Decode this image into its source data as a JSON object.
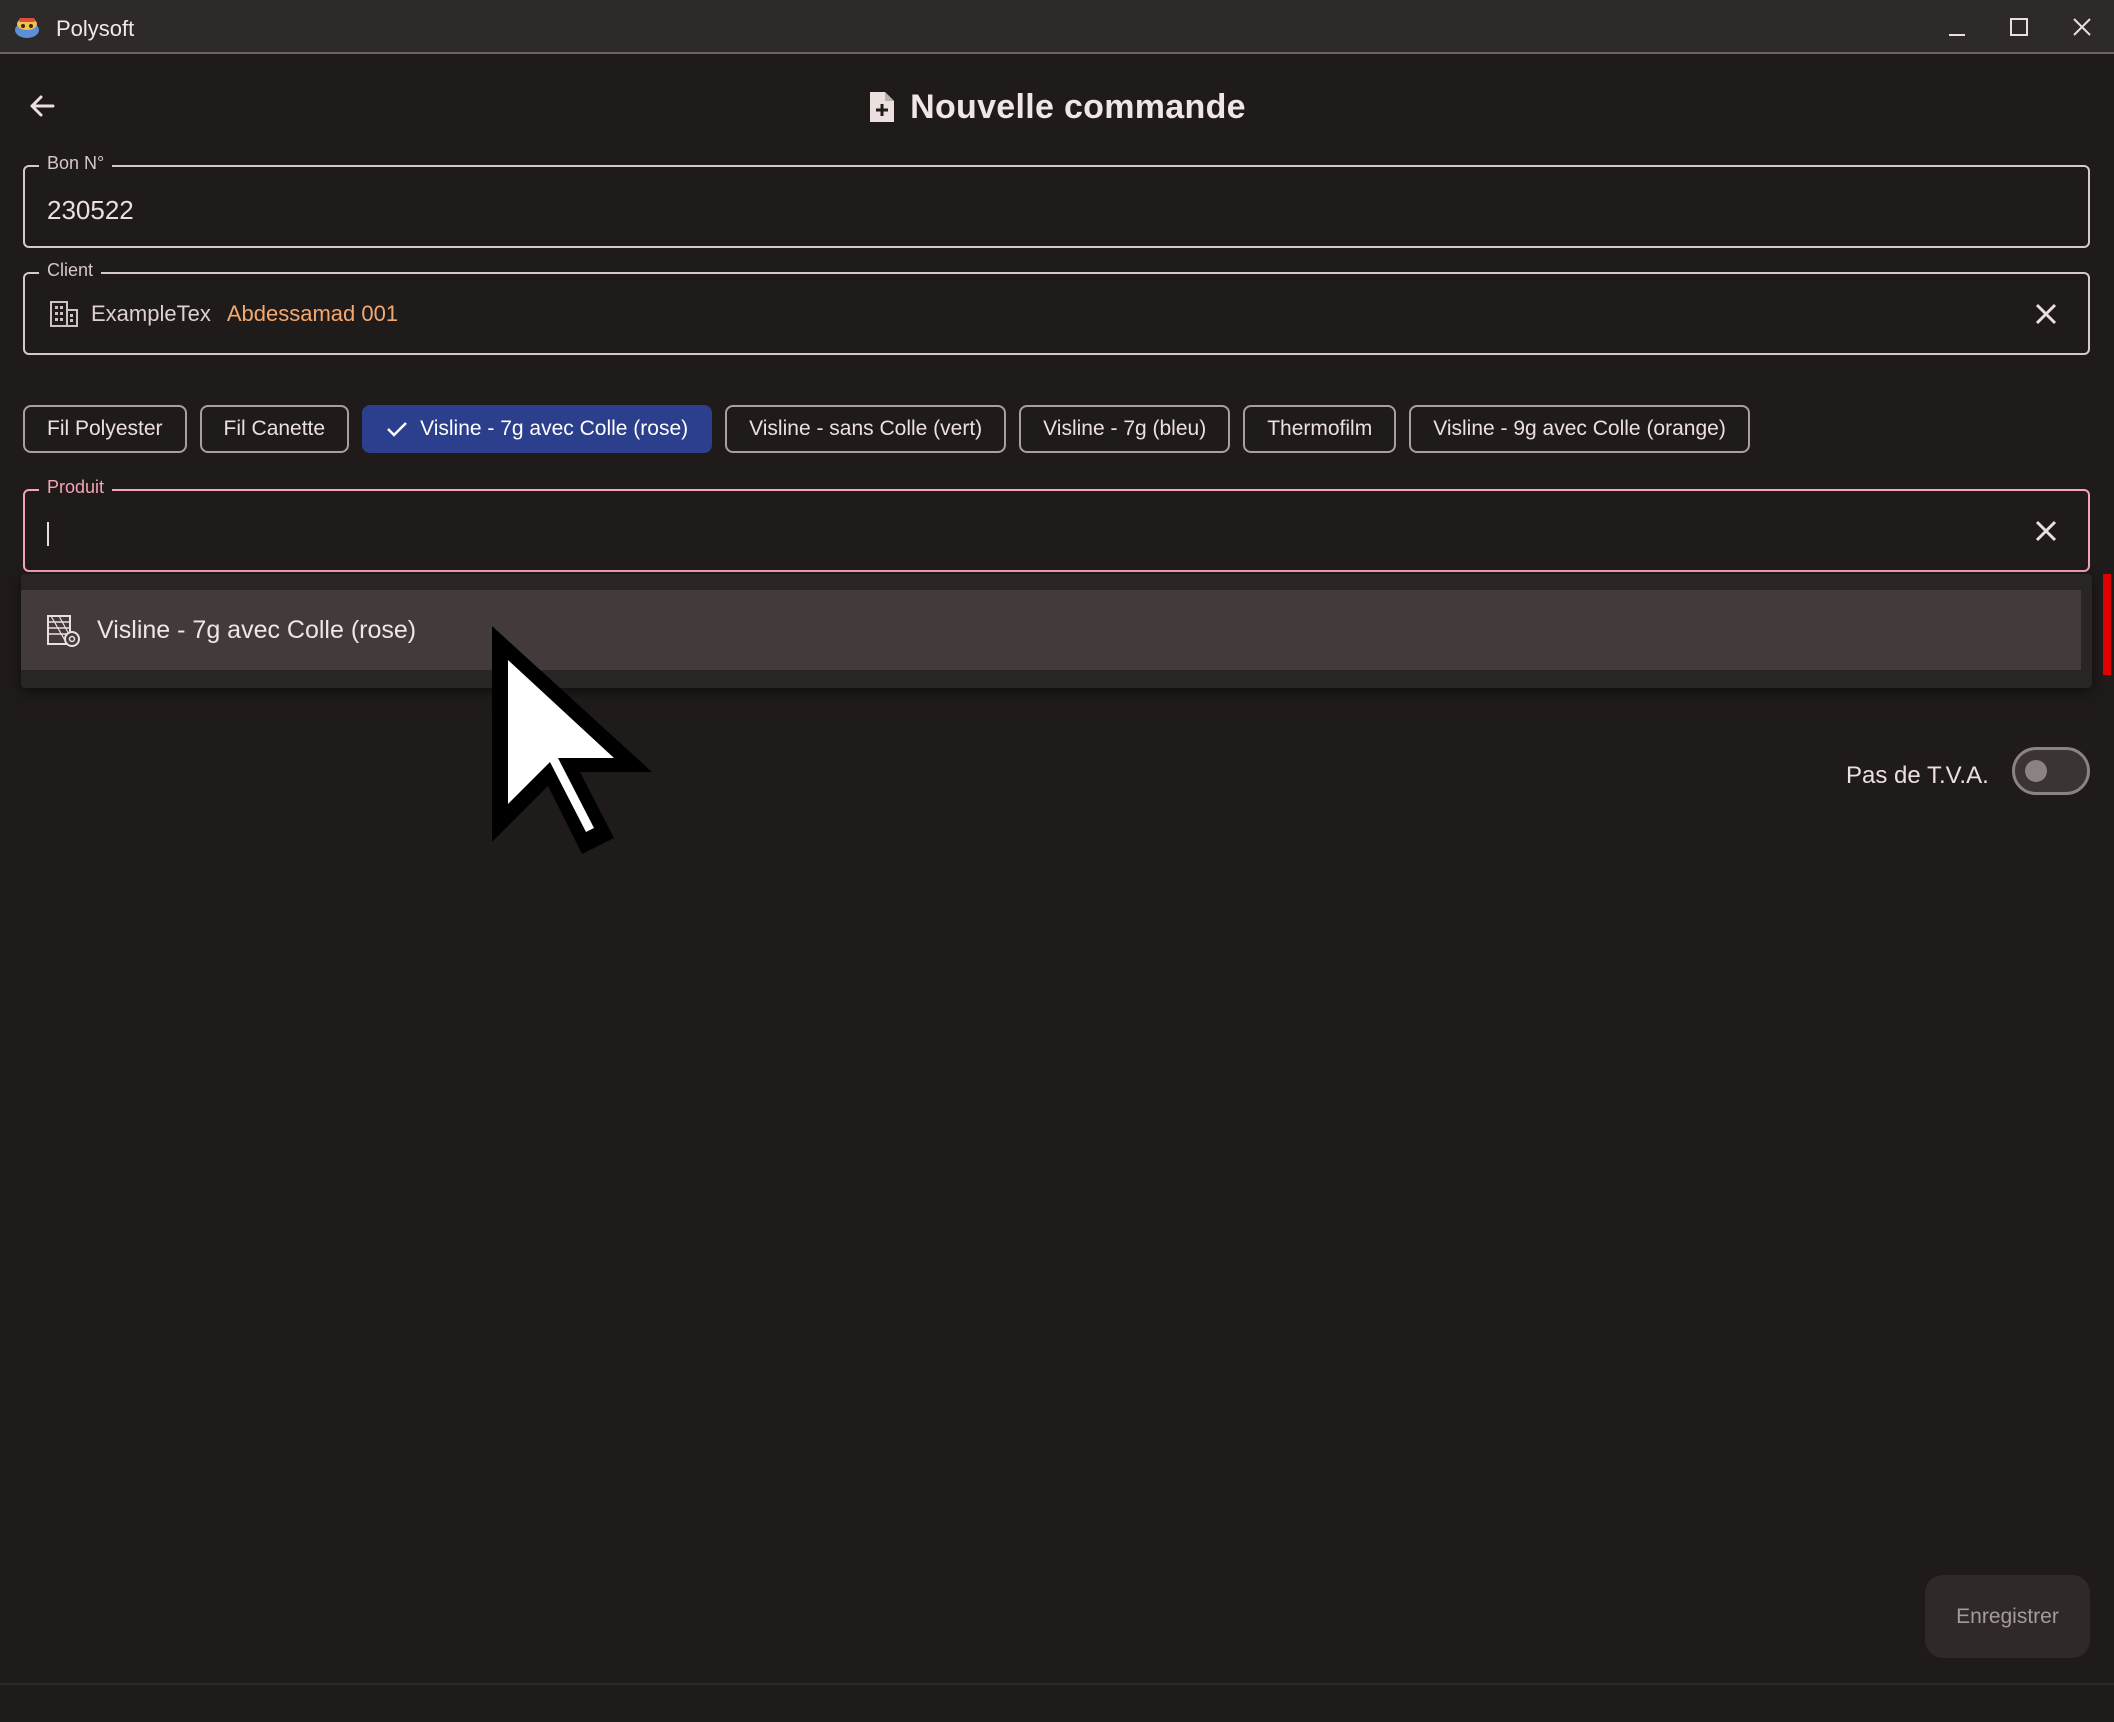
{
  "window": {
    "title": "Polysoft",
    "logo_icon": "app-logo-icon",
    "controls": [
      "minimize-icon",
      "maximize-icon",
      "close-icon"
    ]
  },
  "header": {
    "title": "Nouvelle commande",
    "icon": "new-document-icon",
    "back_icon": "arrow-left-icon"
  },
  "bon": {
    "label": "Bon N°",
    "value": "230522"
  },
  "client": {
    "label": "Client",
    "icon": "building-icon",
    "name": "ExampleTex",
    "code": "Abdessamad 001",
    "code_color": "#f3a96d"
  },
  "categories": [
    {
      "label": "Fil Polyester",
      "selected": false
    },
    {
      "label": "Fil Canette",
      "selected": false
    },
    {
      "label": "Visline - 7g avec Colle (rose)",
      "selected": true
    },
    {
      "label": "Visline - sans Colle (vert)",
      "selected": false
    },
    {
      "label": "Visline - 7g (bleu)",
      "selected": false
    },
    {
      "label": "Thermofilm",
      "selected": false
    },
    {
      "label": "Visline - 9g avec Colle (orange)",
      "selected": false
    }
  ],
  "produit": {
    "label": "Produit",
    "value": "",
    "accent_color": "#f4a4b4"
  },
  "dropdown": {
    "options": [
      {
        "label": "Visline - 7g avec Colle (rose)",
        "icon": "fabric-roll-icon"
      }
    ]
  },
  "tva": {
    "label": "Pas de T.V.A.",
    "enabled": false
  },
  "actions": {
    "save_label": "Enregistrer"
  },
  "theme": {
    "background": "#201b1b",
    "selected_chip": "#2c3f8c"
  }
}
